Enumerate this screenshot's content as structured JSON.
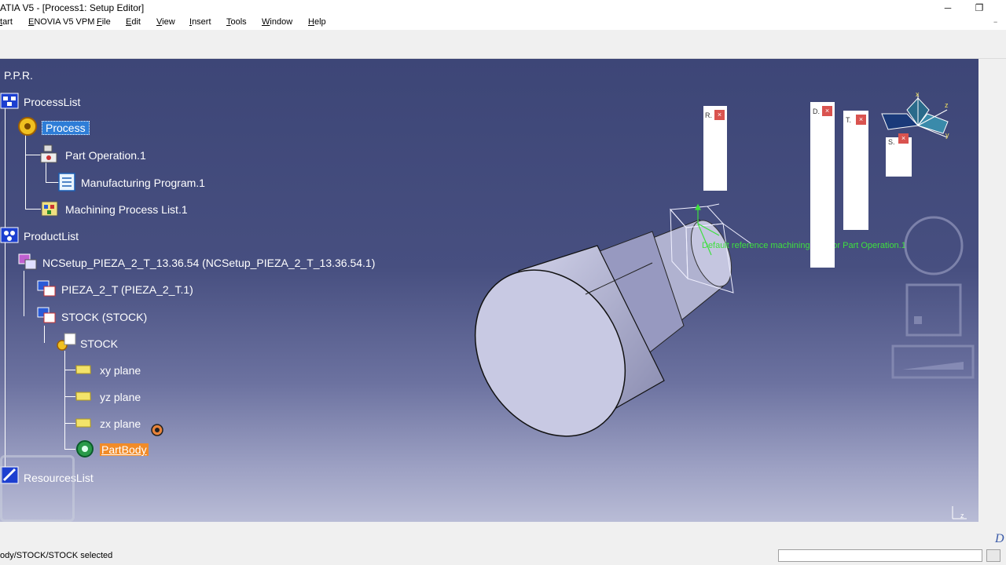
{
  "window": {
    "title": "ATIA V5 - [Process1: Setup Editor]",
    "minimize_glyph": "─",
    "restore_glyph": "❐"
  },
  "menu": [
    "tart",
    "ENOVIA V5 VPM",
    "File",
    "Edit",
    "View",
    "Insert",
    "Tools",
    "Window",
    "Help"
  ],
  "tree": {
    "root_label": "P.P.R.",
    "items": {
      "process_list": "ProcessList",
      "process": "Process",
      "part_operation": "Part Operation.1",
      "manufacturing_program": "Manufacturing Program.1",
      "machining_process_list": "Machining Process List.1",
      "product_list": "ProductList",
      "ncsetup": "NCSetup_PIEZA_2_T_13.36.54 (NCSetup_PIEZA_2_T_13.36.54.1)",
      "pieza": "PIEZA_2_T (PIEZA_2_T.1)",
      "stock_product": "STOCK (STOCK)",
      "stock_part": "STOCK",
      "xy_plane": "xy plane",
      "yz_plane": "yz plane",
      "zx_plane": "zx plane",
      "part_body": "PartBody",
      "resources_list": "ResourcesList"
    }
  },
  "viewport": {
    "machining_axis_label": "Default reference machining axis for Part Operation.1",
    "hud_panels": {
      "r": "R.",
      "d": "D.",
      "t": "T.",
      "s": "S."
    },
    "compass_axis_z": "z",
    "compass_axis_y": "y",
    "compass_axis_x": "x",
    "mini_axis_label": "z"
  },
  "status": {
    "message": "ody/STOCK/STOCK selected",
    "command_placeholder": ""
  },
  "colors": {
    "selection_blue": "#2e7dd7",
    "highlight_orange": "#f18b28",
    "axis_green": "#3ee03e",
    "viewport_top": "#3d4677",
    "viewport_bottom": "#b9bcd6"
  }
}
